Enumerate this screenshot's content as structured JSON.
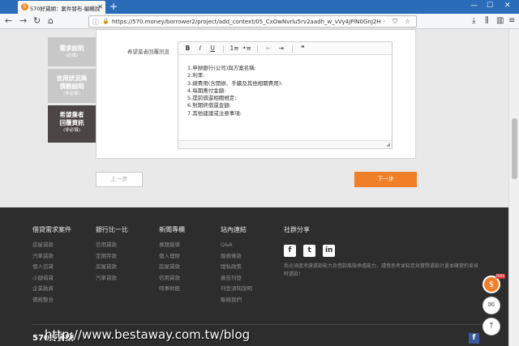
{
  "browser": {
    "tab_title": "570好貸網：案件發布-編輯說",
    "tab_favicon_text": "5",
    "url": "https://570.money/borrower2/project/add_context/05_CxOwNvrlu5rv2aadh_w_vVy4JPlN0GnJ2H",
    "new_tab": "+",
    "window_controls": [
      "—",
      "☐",
      "✕"
    ]
  },
  "sidebar": {
    "steps": [
      {
        "title": "需求說明",
        "note": "(必填)",
        "active": false
      },
      {
        "title": "信用狀況與\n債務說明",
        "note": "(非必填)",
        "active": false
      },
      {
        "title": "希望業者\n回覆資訊",
        "note": "(非必填)",
        "active": true
      }
    ]
  },
  "form": {
    "label": "希望業者回覆訊息",
    "toolbar": [
      "B",
      "I",
      "U",
      "1≡",
      "•≡",
      "⇤",
      "⇥",
      "❞"
    ],
    "content_lines": [
      "1.申辦銀行(公司)與方案名稱:",
      "2.利率:",
      "3.總費用(含開辦、手續及其他相關費用):",
      "4.每期應付金額:",
      "5.提前償還相關規定:",
      "6.對期終償還金額:",
      "7.其他建議或注意事項:"
    ]
  },
  "buttons": {
    "prev": "上一步",
    "next": "下一步"
  },
  "footer": {
    "columns": [
      {
        "heading": "借貸需求案件",
        "links": [
          "房屋貸款",
          "汽車貸款",
          "個人信貸",
          "小額借貸",
          "企業融資",
          "債務整合"
        ]
      },
      {
        "heading": "銀行比一比",
        "links": [
          "信用貸款",
          "定期存款",
          "房屋貸款",
          "汽車貸款"
        ]
      },
      {
        "heading": "新聞專欄",
        "links": [
          "專題報導",
          "個人理財",
          "房屋貸款",
          "信用貸款",
          "時事財經"
        ]
      },
      {
        "heading": "站內連結",
        "links": [
          "Q&A",
          "服務條款",
          "隱私政策",
          "廣告刊登",
          "刊登須知說明",
          "聯絡我們"
        ]
      }
    ],
    "social": {
      "heading": "社群分享",
      "icons": [
        "f",
        "t",
        "in"
      ],
      "text": "我必須進考慮還款能力及借款風險承擔能力，謹慎思考並知足與實際還款計畫並確實約束按時還款！"
    },
    "logo": "570好貸網",
    "watermark": "http://www.bestaway.com.tw/blog"
  },
  "floating": {
    "badge": "FREE",
    "icons": [
      "hand-coin-icon",
      "mail-icon",
      "arrow-up-icon"
    ]
  }
}
